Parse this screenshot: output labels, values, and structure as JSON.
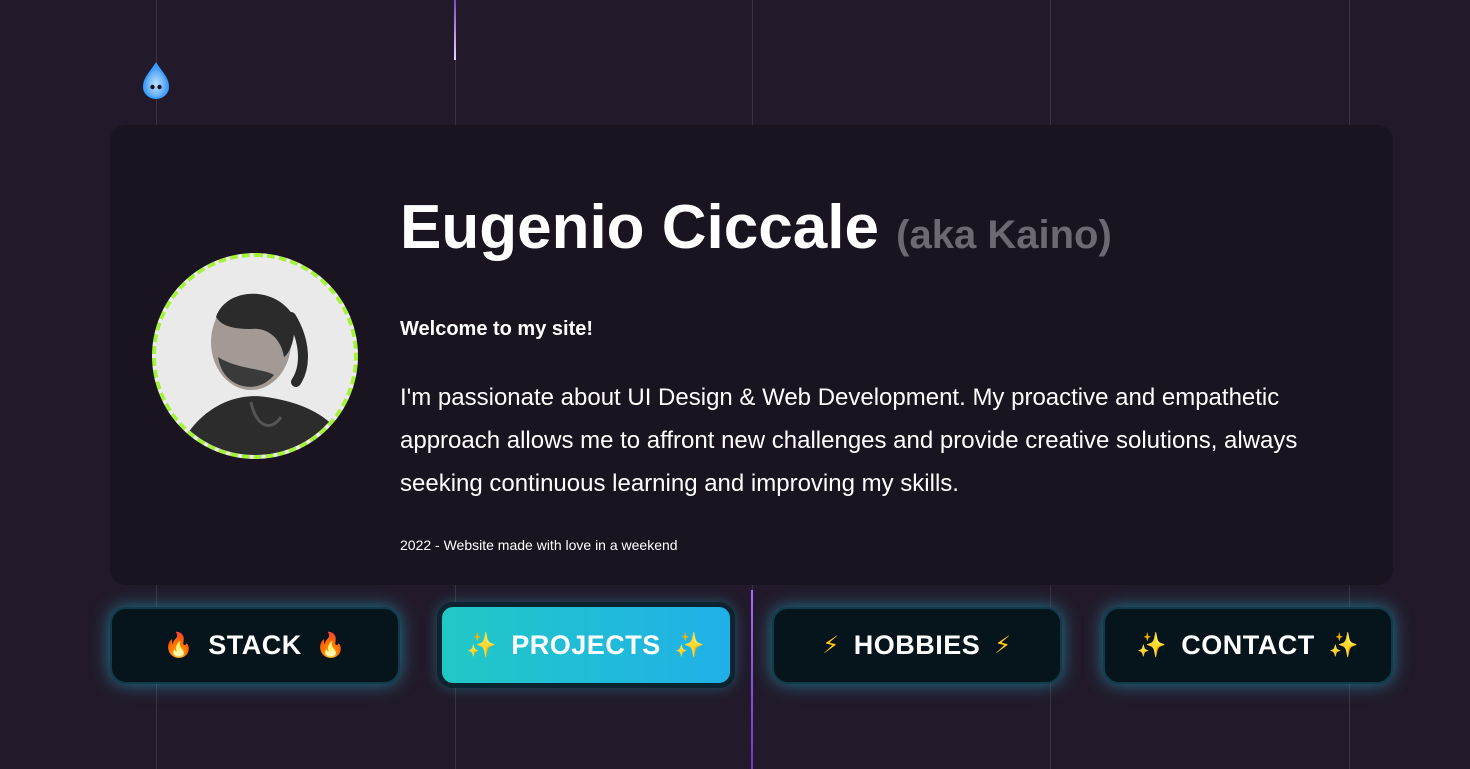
{
  "profile": {
    "name": "Eugenio Ciccale",
    "aka": "(aka Kaino)",
    "welcome": "Welcome to my site!",
    "bio": "I'm passionate about UI Design & Web Development. My proactive and empathetic approach allows me to affront new challenges and provide creative solutions, always seeking continuous learning and improving my skills.",
    "footer_note": "2022 - Website made with love in a weekend",
    "avatar_icon": "person-photo",
    "avatar_border_color": "#a6f13b"
  },
  "nav": {
    "stack": {
      "label": "STACK",
      "emoji": "🔥"
    },
    "projects": {
      "label": "PROJECTS",
      "emoji": "✨",
      "active": true
    },
    "hobbies": {
      "label": "HOBBIES",
      "emoji": "⚡"
    },
    "contact": {
      "label": "CONTACT",
      "emoji": "✨"
    }
  },
  "colors": {
    "background": "#221a2a",
    "card": "#1a1320",
    "accent_cyan": "#20b0e8",
    "accent_green": "#a6f13b"
  },
  "logo": {
    "icon": "ghost-drop-icon"
  }
}
